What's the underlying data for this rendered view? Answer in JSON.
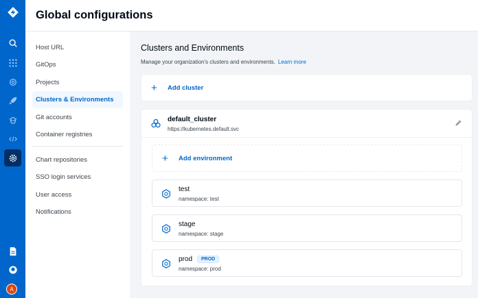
{
  "header": {
    "title": "Global configurations"
  },
  "rail": {
    "icons": [
      "logo-icon",
      "search-icon",
      "apps-icon",
      "chart-store-icon",
      "deploy-rocket-icon",
      "bug-icon",
      "code-icon",
      "gear-icon",
      "docs-icon",
      "github-icon"
    ],
    "avatar": "A",
    "accent": "#0066cc"
  },
  "sidebar": {
    "items": [
      {
        "label": "Host URL"
      },
      {
        "label": "GitOps"
      },
      {
        "label": "Projects"
      },
      {
        "label": "Clusters & Environments"
      },
      {
        "label": "Git accounts"
      },
      {
        "label": "Container registries"
      },
      {
        "label": "Chart repositories"
      },
      {
        "label": "SSO login services"
      },
      {
        "label": "User access"
      },
      {
        "label": "Notifications"
      }
    ],
    "selected": "Clusters & Environments"
  },
  "main": {
    "title": "Clusters and Environments",
    "subtitle": "Manage your organization's clusters and environments.",
    "learn_more": "Learn more",
    "add_cluster": "Add cluster",
    "cluster": {
      "name": "default_cluster",
      "url": "https://kubernetes.default.svc",
      "add_environment": "Add environment",
      "environments": [
        {
          "name": "test",
          "namespace": "namespace: test",
          "badge": ""
        },
        {
          "name": "stage",
          "namespace": "namespace: stage",
          "badge": ""
        },
        {
          "name": "prod",
          "namespace": "namespace: prod",
          "badge": "PROD"
        }
      ]
    }
  }
}
